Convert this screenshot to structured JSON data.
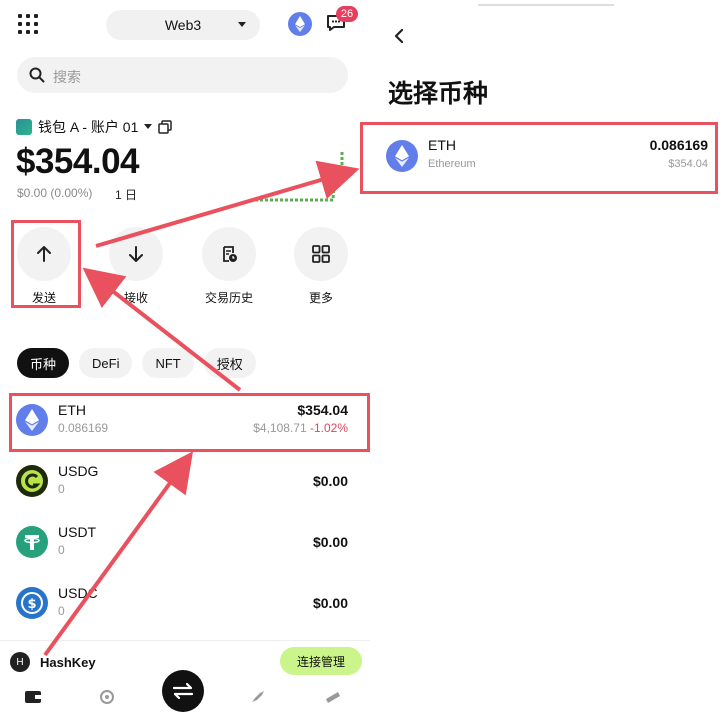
{
  "left": {
    "topbar": {
      "network": "Web3",
      "badge_count": "26"
    },
    "search": {
      "placeholder": "搜索"
    },
    "wallet": {
      "name": "钱包 A - 账户 01"
    },
    "balance": "$354.04",
    "change": "$0.00 (0.00%)",
    "period": "1 日",
    "actions": [
      {
        "label": "发送",
        "icon": "arrow-up-icon"
      },
      {
        "label": "接收",
        "icon": "arrow-down-icon"
      },
      {
        "label": "交易历史",
        "icon": "history-icon"
      },
      {
        "label": "更多",
        "icon": "grid-icon"
      }
    ],
    "tabs": [
      "币种",
      "DeFi",
      "NFT",
      "授权"
    ],
    "assets": [
      {
        "symbol": "ETH",
        "amount": "0.086169",
        "value": "$354.04",
        "price": "$4,108.71",
        "change": "-1.02%",
        "color": "#627eea"
      },
      {
        "symbol": "USDG",
        "amount": "0",
        "value": "$0.00",
        "color": "#1f2a0a"
      },
      {
        "symbol": "USDT",
        "amount": "0",
        "value": "$0.00",
        "color": "#26a17b"
      },
      {
        "symbol": "USDC",
        "amount": "0",
        "value": "$0.00",
        "color": "#2775ca"
      }
    ],
    "dapp_bar": {
      "name": "HashKey",
      "button": "连接管理"
    }
  },
  "right": {
    "title": "选择币种",
    "asset": {
      "symbol": "ETH",
      "full_name": "Ethereum",
      "balance": "0.086169",
      "value": "$354.04"
    }
  },
  "colors": {
    "annotation": "#e8515d",
    "accent_green": "#cbf48a",
    "eth": "#627eea",
    "negative": "#e0475e"
  }
}
